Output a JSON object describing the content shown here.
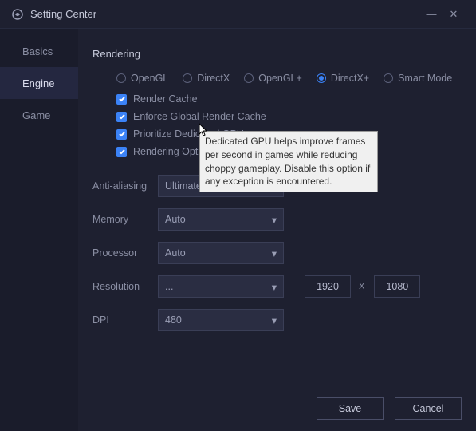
{
  "titlebar": {
    "title": "Setting Center"
  },
  "sidebar": {
    "items": [
      {
        "label": "Basics"
      },
      {
        "label": "Engine"
      },
      {
        "label": "Game"
      }
    ]
  },
  "main": {
    "section_title": "Rendering",
    "render_options": {
      "opengl": "OpenGL",
      "directx": "DirectX",
      "openglp": "OpenGL+",
      "directxp": "DirectX+",
      "smart": "Smart Mode"
    },
    "checkboxes": {
      "render_cache": "Render Cache",
      "enforce_global": "Enforce Global Render Cache",
      "prioritize_gpu": "Prioritize Dedicated GPU",
      "render_opt": "Rendering Optimization"
    },
    "tooltip": "Dedicated GPU helps improve frames per second in games while reducing choppy gameplay. Disable this option if any exception is encountered.",
    "labels": {
      "aa": "Anti-aliasing",
      "memory": "Memory",
      "processor": "Processor",
      "resolution": "Resolution",
      "dpi": "DPI"
    },
    "values": {
      "aa": "Ultimate",
      "memory": "Auto",
      "processor": "Auto",
      "resolution": "...",
      "dpi": "480",
      "res_w": "1920",
      "res_h": "1080",
      "mult": "X"
    }
  },
  "footer": {
    "save": "Save",
    "cancel": "Cancel"
  }
}
